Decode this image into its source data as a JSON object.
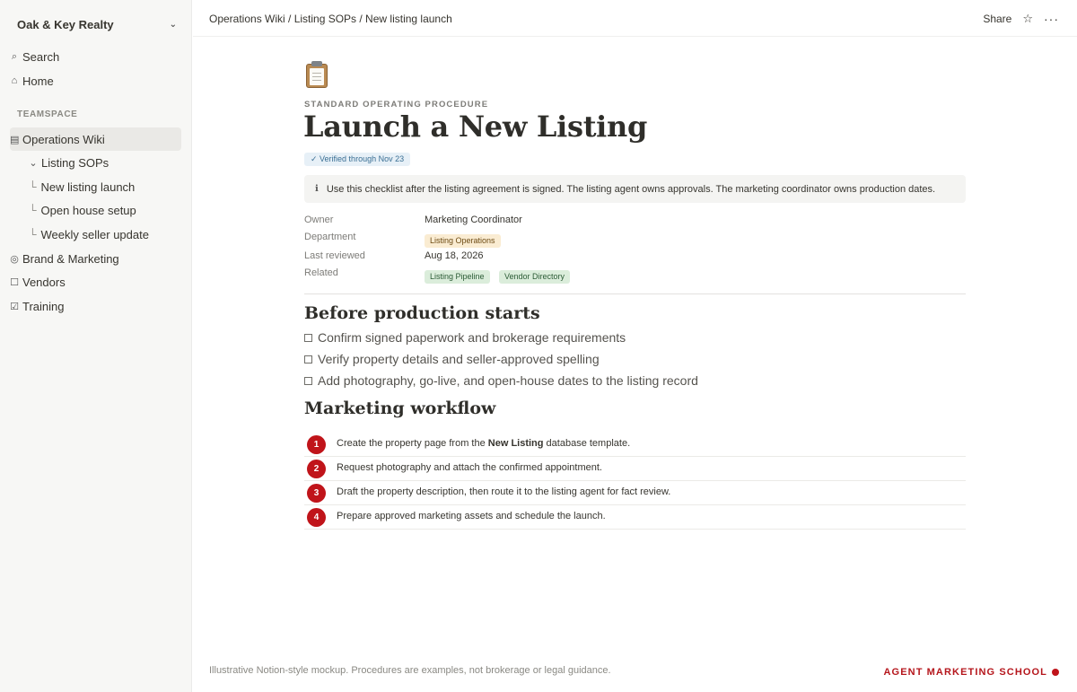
{
  "sidebar": {
    "workspace": "Oak & Key Realty",
    "search": "Search",
    "home": "Home",
    "section": "TEAMSPACE",
    "items": [
      {
        "label": "Operations Wiki",
        "icon": "▤"
      },
      {
        "label": "Listing SOPs",
        "icon": "⌄"
      },
      {
        "label": "New listing launch",
        "icon": "└"
      },
      {
        "label": "Open house setup",
        "icon": "└"
      },
      {
        "label": "Weekly seller update",
        "icon": "└"
      },
      {
        "label": "Brand & Marketing",
        "icon": "◎"
      },
      {
        "label": "Vendors",
        "icon": "☐"
      },
      {
        "label": "Training",
        "icon": "☑"
      }
    ]
  },
  "topbar": {
    "breadcrumb": "Operations Wiki / Listing SOPs / New listing launch",
    "share": "Share",
    "star": "☆",
    "more": "···"
  },
  "page": {
    "icon": "clipboard-icon",
    "eyebrow": "STANDARD OPERATING PROCEDURE",
    "title": "Launch a New Listing",
    "verified": "✓ Verified through Nov 23",
    "callout_icon": "ℹ",
    "callout": "Use this checklist after the listing agreement is signed. The listing agent owns approvals. The marketing coordinator owns production dates."
  },
  "properties": {
    "owner_label": "Owner",
    "owner_value": "Marketing Coordinator",
    "department_label": "Department",
    "department_value": "Listing Operations",
    "reviewed_label": "Last reviewed",
    "reviewed_value": "Aug 18, 2026",
    "related_label": "Related",
    "related_values": [
      "Listing Pipeline",
      "Vendor Directory"
    ]
  },
  "before": {
    "heading": "Before production starts",
    "todos": [
      "Confirm signed paperwork and brokerage requirements",
      "Verify property details and seller-approved spelling",
      "Add photography, go-live, and open-house dates to the listing record"
    ]
  },
  "workflow": {
    "heading": "Marketing workflow",
    "steps": [
      {
        "num": "1",
        "pre": "Create the property page from the ",
        "bold": "New Listing",
        "post": " database template."
      },
      {
        "num": "2",
        "pre": "Request photography and attach the confirmed appointment.",
        "bold": "",
        "post": ""
      },
      {
        "num": "3",
        "pre": "Draft the property description, then route it to the listing agent for fact review.",
        "bold": "",
        "post": ""
      },
      {
        "num": "4",
        "pre": "Prepare approved marketing assets and schedule the launch.",
        "bold": "",
        "post": ""
      }
    ]
  },
  "footer": {
    "note": "Illustrative Notion-style mockup. Procedures are examples, not brokerage or legal guidance.",
    "brand": "AGENT MARKETING SCHOOL"
  },
  "colors": {
    "accent": "#c0141a",
    "sidebar_bg": "#f7f7f5",
    "tag_orange": "#faecd2",
    "tag_green": "#dbeddb",
    "verified_bg": "#e7f0f7"
  }
}
